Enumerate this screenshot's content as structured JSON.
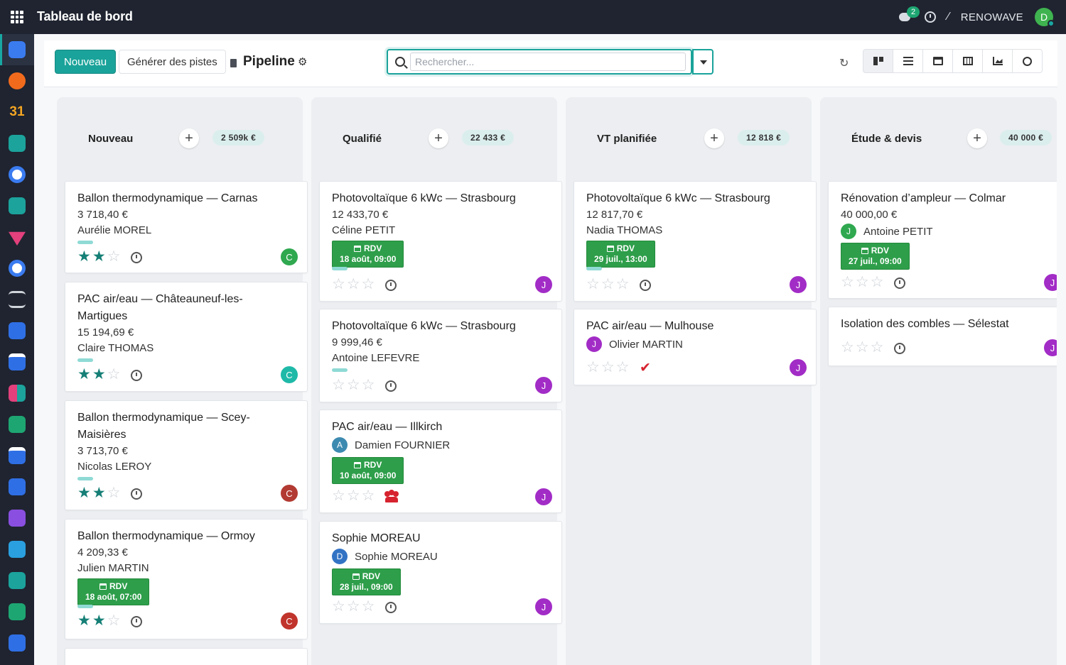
{
  "topbar": {
    "title": "Tableau de bord",
    "chat_count": "2",
    "company": "RENOWAVE",
    "user_initial": "D"
  },
  "control": {
    "new_label": "Nouveau",
    "leads_label": "Générer des pistes",
    "page_title": "Pipeline",
    "search_placeholder": "Rechercher..."
  },
  "colors": {
    "primary": "#1aa39a",
    "rdv": "#2e9e4a",
    "avatar_green": "#2fa84f",
    "avatar_teal": "#1fb9a8",
    "avatar_red": "#b23a32",
    "avatar_purple": "#a22cc6",
    "avatar_blue": "#3273c4"
  },
  "columns": [
    {
      "title": "Nouveau",
      "total": "2 509k €",
      "cards": [
        {
          "title": "Ballon thermodynamique — Carnas",
          "amount": "3 718,40 €",
          "contact": "Aurélie MOREL",
          "stars": 2,
          "avatar": "C"
        },
        {
          "title": "PAC air/eau — Châteauneuf-les-",
          "title2": "Martigues",
          "amount": "15 194,69 €",
          "contact": "Claire THOMAS",
          "stars": 2,
          "avatar": "C"
        },
        {
          "title": "Ballon thermodynamique — Scey-",
          "title2": "Maisières",
          "amount": "3 713,70 €",
          "contact": "Nicolas LEROY",
          "stars": 2,
          "avatar": "C"
        },
        {
          "title": "Ballon thermodynamique — Ormoy",
          "amount": "4 209,33 €",
          "contact": "Julien MARTIN",
          "rdv": "RDV",
          "rdv_date": "18 août, 07:00",
          "stars": 2,
          "avatar": "C"
        }
      ]
    },
    {
      "title": "Qualifié",
      "total": "22 433 €",
      "cards": [
        {
          "title": "Photovoltaïque 6 kWc — Strasbourg",
          "amount": "12 433,70 €",
          "contact": "Céline PETIT",
          "rdv": "RDV",
          "rdv_date": "18 août, 09:00",
          "stars": 0,
          "avatar": "J"
        },
        {
          "title": "Photovoltaïque 6 kWc — Strasbourg",
          "amount": "9 999,46 €",
          "contact": "Antoine LEFEVRE",
          "stars": 0,
          "avatar": "J"
        },
        {
          "title": "PAC air/eau — Illkirch",
          "contact_initial": "A",
          "contact": "Damien FOURNIER",
          "rdv": "RDV",
          "rdv_date": "10 août, 09:00",
          "stars": 0,
          "avatar": "J"
        },
        {
          "title": "Sophie MOREAU",
          "contact_initial": "D",
          "contact": "Sophie MOREAU",
          "rdv": "RDV",
          "rdv_date": "28 juil., 09:00",
          "stars": 0,
          "avatar": "J"
        }
      ]
    },
    {
      "title": "VT planifiée",
      "total": "12 818 €",
      "cards": [
        {
          "title": "Photovoltaïque 6 kWc — Strasbourg",
          "amount": "12 817,70 €",
          "contact": "Nadia THOMAS",
          "rdv": "RDV",
          "rdv_date": "29 juil., 13:00",
          "stars": 0,
          "avatar": "J"
        },
        {
          "title": "PAC air/eau — Mulhouse",
          "contact_initial": "J",
          "contact": "Olivier MARTIN",
          "stars": 0,
          "avatar": "J"
        }
      ]
    },
    {
      "title": "Étude & devis",
      "total": "40 000 €",
      "cards": [
        {
          "title": "Rénovation d’ampleur — Colmar",
          "amount": "40 000,00 €",
          "contact_initial": "J",
          "contact": "Antoine PETIT",
          "rdv": "RDV",
          "rdv_date": "27 juil., 09:00",
          "stars": 0,
          "avatar": "J"
        },
        {
          "title": "Isolation des combles — Sélestat",
          "stars": 0,
          "avatar": "J"
        }
      ]
    }
  ],
  "rail_icons": [
    "apps-grid-icon",
    "discuss-icon",
    "crm-icon",
    "calendar-31-icon",
    "sign-icon",
    "project-icon",
    "contacts-icon",
    "marketing-icon",
    "timesheet-icon",
    "bank-icon",
    "documents-icon",
    "planning-icon",
    "dashboards-icon",
    "spreadsheet-icon",
    "appointments-icon",
    "blue-app-icon",
    "purple-app-icon",
    "subscriptions-icon",
    "employees-icon",
    "inventory-icon",
    "tasks-icon"
  ]
}
